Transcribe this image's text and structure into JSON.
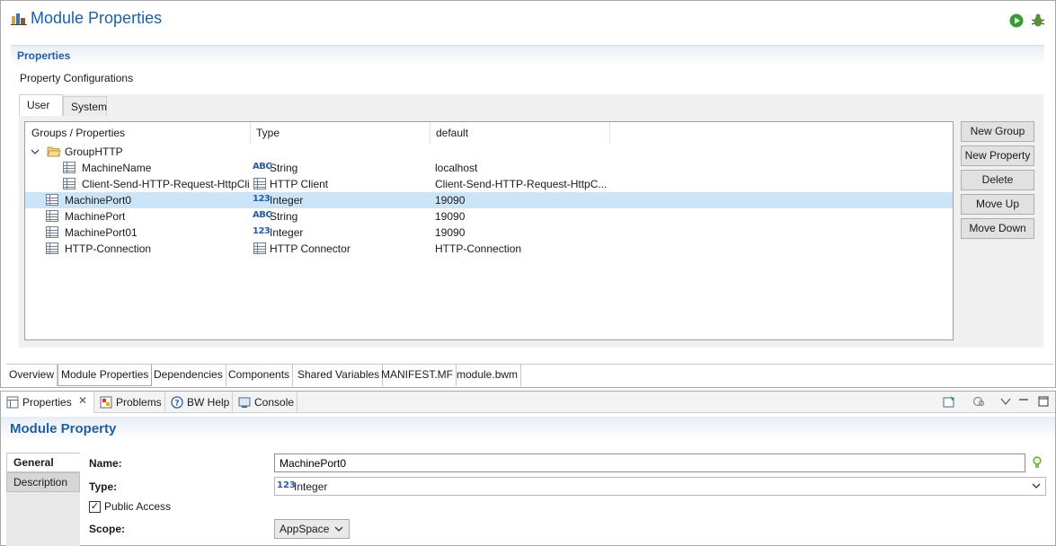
{
  "editor": {
    "title": "Module Properties",
    "section_title": "Properties",
    "section_desc": "Property Configurations",
    "tabs": [
      {
        "label": "User"
      },
      {
        "label": "System"
      }
    ],
    "tree": {
      "columns": [
        "Groups / Properties",
        "Type",
        "default"
      ],
      "rows": [
        {
          "name": "GroupHTTP",
          "type": "",
          "default": "",
          "kind": "group"
        },
        {
          "name": "MachineName",
          "type": "String",
          "type_glyph": "ABC",
          "default": "localhost"
        },
        {
          "name": "Client-Send-HTTP-Request-HttpCli",
          "type": "HTTP Client",
          "type_glyph": "grid",
          "default": "Client-Send-HTTP-Request-HttpC..."
        },
        {
          "name": "MachinePort0",
          "type": "Integer",
          "type_glyph": "123",
          "default": "19090",
          "selected": true
        },
        {
          "name": "MachinePort",
          "type": "String",
          "type_glyph": "ABC",
          "default": "19090"
        },
        {
          "name": "MachinePort01",
          "type": "Integer",
          "type_glyph": "123",
          "default": "19090"
        },
        {
          "name": "HTTP-Connection",
          "type": "HTTP Connector",
          "type_glyph": "grid",
          "default": "HTTP-Connection"
        }
      ]
    },
    "buttons": {
      "new_group": "New Group",
      "new_property": "New Property",
      "delete": "Delete",
      "move_up": "Move Up",
      "move_down": "Move Down"
    },
    "editor_tabs": [
      "Overview",
      "Module Properties",
      "Dependencies",
      "Components",
      "Shared Variables",
      "MANIFEST.MF",
      "module.bwm"
    ]
  },
  "view": {
    "tabs": [
      {
        "label": "Properties"
      },
      {
        "label": "Problems"
      },
      {
        "label": "BW Help"
      },
      {
        "label": "Console"
      }
    ],
    "title": "Module Property",
    "side_tabs": [
      "General",
      "Description"
    ],
    "fields": {
      "name_label": "Name:",
      "name_value": "MachinePort0",
      "type_label": "Type:",
      "type_glyph": "123",
      "type_value": "Integer",
      "public_access_label": "Public Access",
      "public_access_checked": true,
      "scope_label": "Scope:",
      "scope_value": "AppSpace"
    }
  }
}
